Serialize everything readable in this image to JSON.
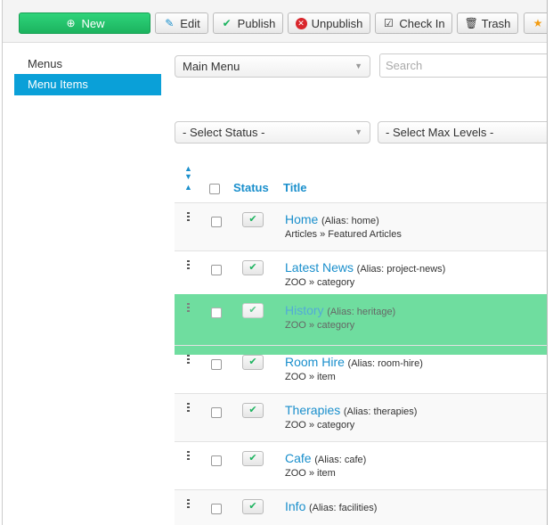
{
  "toolbar": {
    "buttons": [
      {
        "label": "New",
        "icon": "plus-circle-icon"
      },
      {
        "label": "Edit",
        "icon": "edit-icon"
      },
      {
        "label": "Publish",
        "icon": "check-icon"
      },
      {
        "label": "Unpublish",
        "icon": "x-circle-icon"
      },
      {
        "label": "Check In",
        "icon": "checkbox-icon"
      },
      {
        "label": "Trash",
        "icon": "trash-icon"
      },
      {
        "label": "",
        "icon": "star-icon"
      }
    ]
  },
  "sidebar": {
    "items": [
      {
        "label": "Menus"
      },
      {
        "label": "Menu Items",
        "active": true
      }
    ]
  },
  "filters": {
    "menu": "Main Menu",
    "search_placeholder": "Search",
    "status": "- Select Status -",
    "max_levels": "- Select Max Levels -"
  },
  "table": {
    "headers": {
      "status": "Status",
      "title": "Title"
    },
    "rows": [
      {
        "title": "Home",
        "alias": "(Alias: home)",
        "type": "Articles » Featured Articles"
      },
      {
        "title": "Latest News",
        "alias": "(Alias: project-news)",
        "type": "ZOO » category"
      },
      {
        "title": "History",
        "alias": "(Alias: heritage)",
        "type": "ZOO » category",
        "dragging": true
      },
      {
        "title": "Room Hire",
        "alias": "(Alias: room-hire)",
        "type": "ZOO » item"
      },
      {
        "title": "Therapies",
        "alias": "(Alias: therapies)",
        "type": "ZOO » category"
      },
      {
        "title": "Cafe",
        "alias": "(Alias: cafe)",
        "type": "ZOO » item"
      },
      {
        "title": "Info",
        "alias": "(Alias: facilities)",
        "type": ""
      }
    ]
  },
  "colors": {
    "accent": "#0aa0d8",
    "new_button": "#1cb35f",
    "drag_highlight": "#3fd27f"
  }
}
